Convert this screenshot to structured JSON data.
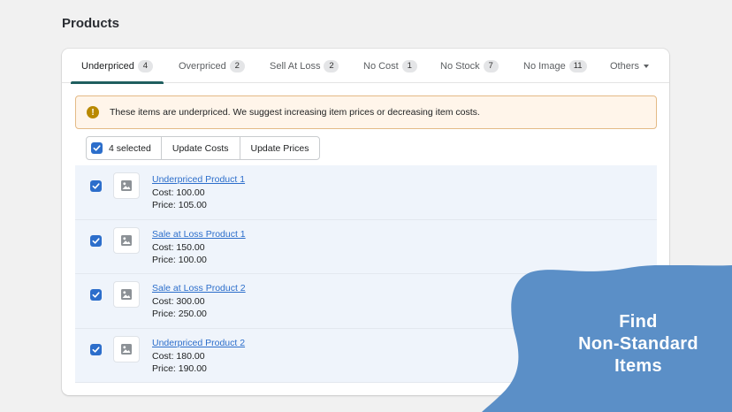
{
  "page": {
    "title": "Products"
  },
  "tabs": [
    {
      "label": "Underpriced",
      "count": "4"
    },
    {
      "label": "Overpriced",
      "count": "2"
    },
    {
      "label": "Sell At Loss",
      "count": "2"
    },
    {
      "label": "No Cost",
      "count": "1"
    },
    {
      "label": "No Stock",
      "count": "7"
    },
    {
      "label": "No Image",
      "count": "11"
    },
    {
      "label": "Others"
    }
  ],
  "active_tab": "Underpriced",
  "banner": {
    "icon": "exclamation-icon",
    "text": "These items are underpriced. We suggest increasing item prices or decreasing item costs.",
    "color": "#b98900"
  },
  "bulk_actions": {
    "selected_label": "4 selected",
    "update_costs": "Update Costs",
    "update_prices": "Update Prices"
  },
  "items": [
    {
      "name": "Underpriced Product 1",
      "cost": "Cost: 100.00",
      "price": "Price: 105.00",
      "checked": true
    },
    {
      "name": "Sale at Loss Product 1",
      "cost": "Cost: 150.00",
      "price": "Price: 100.00",
      "checked": true
    },
    {
      "name": "Sale at Loss Product 2",
      "cost": "Cost: 300.00",
      "price": "Price: 250.00",
      "checked": true
    },
    {
      "name": "Underpriced Product 2",
      "cost": "Cost: 180.00",
      "price": "Price: 190.00",
      "checked": true
    }
  ],
  "promo": {
    "line1": "Find",
    "line2": "Non-Standard",
    "line3": "Items",
    "color": "#5b8fc7"
  },
  "colors": {
    "accent": "#2c6ecb",
    "tab_indicator": "#1f5e5f",
    "row_selected_bg": "#eff4fb",
    "banner_bg": "#fff5ea"
  }
}
